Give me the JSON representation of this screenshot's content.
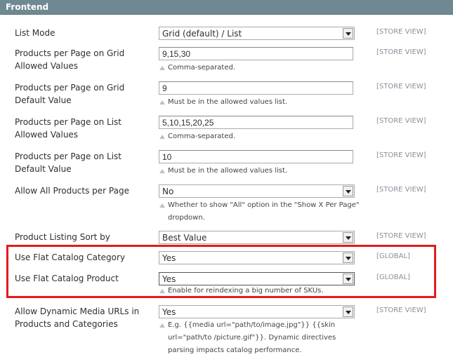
{
  "section": {
    "title": "Frontend"
  },
  "rows": [
    {
      "label": "List Mode",
      "type": "select",
      "value": "Grid (default) / List",
      "scope": "[STORE VIEW]",
      "note": ""
    },
    {
      "label": "Products per Page on Grid Allowed Values",
      "type": "text",
      "value": "9,15,30",
      "scope": "[STORE VIEW]",
      "note": "Comma-separated."
    },
    {
      "label": "Products per Page on Grid Default Value",
      "type": "text",
      "value": "9",
      "scope": "[STORE VIEW]",
      "note": "Must be in the allowed values list."
    },
    {
      "label": "Products per Page on List Allowed Values",
      "type": "text",
      "value": "5,10,15,20,25",
      "scope": "[STORE VIEW]",
      "note": "Comma-separated."
    },
    {
      "label": "Products per Page on List Default Value",
      "type": "text",
      "value": "10",
      "scope": "[STORE VIEW]",
      "note": "Must be in the allowed values list."
    },
    {
      "label": "Allow All Products per Page",
      "type": "select",
      "value": "No",
      "scope": "[STORE VIEW]",
      "note": "Whether to show \"All\" option in the \"Show X Per Page\" dropdown."
    },
    {
      "label": "Product Listing Sort by",
      "type": "select",
      "value": "Best Value",
      "scope": "[STORE VIEW]",
      "note": ""
    },
    {
      "label": "Use Flat Catalog Category",
      "type": "select",
      "value": "Yes",
      "scope": "[GLOBAL]",
      "note": ""
    },
    {
      "label": "Use Flat Catalog Product",
      "type": "select",
      "value": "Yes",
      "scope": "[GLOBAL]",
      "note": "Enable for reindexing a big number of SKUs."
    },
    {
      "label": "Allow Dynamic Media URLs in Products and Categories",
      "type": "select",
      "value": "Yes",
      "scope": "[STORE VIEW]",
      "note": "E.g. {{media url=\"path/to/image.jpg\"}} {{skin url=\"path/to /picture.gif\"}}. Dynamic directives parsing impacts catalog performance."
    }
  ],
  "colors": {
    "header": "#6f8992",
    "highlight": "#e21b1b",
    "scope": "#8a8f99"
  }
}
